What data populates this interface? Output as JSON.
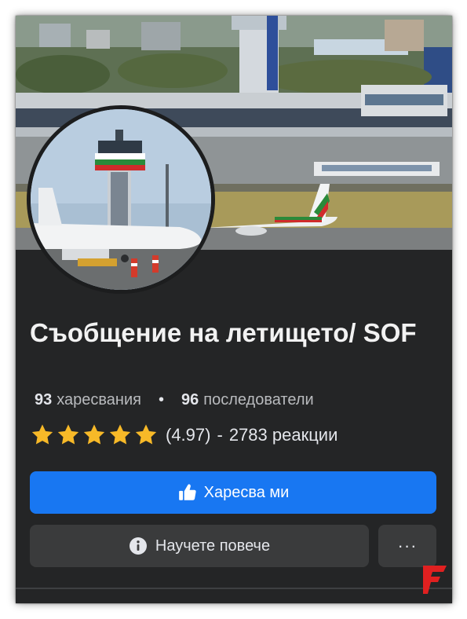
{
  "page": {
    "title": "Съобщение на летището/ SOF"
  },
  "stats": {
    "likes_count": "93",
    "likes_label": "харесвания",
    "separator": "•",
    "followers_count": "96",
    "followers_label": "последователи"
  },
  "rating": {
    "stars": 5,
    "score": "(4.97)",
    "dash": "-",
    "reviews": "2783 реакции"
  },
  "buttons": {
    "like_label": "Харесва ми",
    "learn_more_label": "Научете повече",
    "more_label": "···"
  },
  "icons": {
    "like": "thumbs-up-icon",
    "info": "info-icon",
    "star": "star-icon",
    "watermark": "flag-logo-icon"
  },
  "colors": {
    "primary": "#1877f2",
    "background": "#242526",
    "button": "#3a3b3c",
    "star": "#f7b928",
    "watermark": "#e02020"
  }
}
